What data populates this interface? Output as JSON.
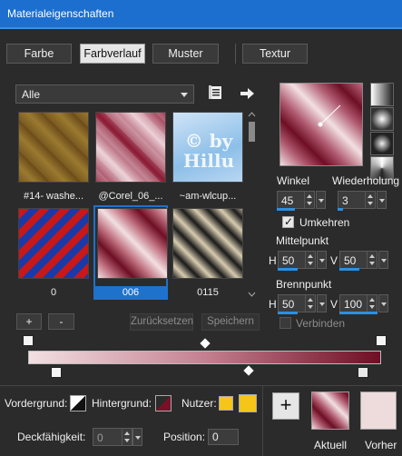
{
  "window": {
    "title": "Materialeigenschaften"
  },
  "tabs": [
    {
      "label": "Farbe"
    },
    {
      "label": "Farbverlauf"
    },
    {
      "label": "Muster"
    },
    {
      "label": "Textur"
    }
  ],
  "active_tab": "Farbverlauf",
  "preset_dropdown": {
    "value": "Alle"
  },
  "gallery": {
    "items": [
      {
        "label": "#14- washe..."
      },
      {
        "label": "@Corel_06_..."
      },
      {
        "label": "~am-wlcup..."
      },
      {
        "label": "0"
      },
      {
        "label": "006"
      },
      {
        "label": "0115"
      }
    ],
    "selected": "006",
    "watermark": "© by Hillu"
  },
  "gallery_buttons": {
    "add": "+",
    "remove": "-",
    "reset": "Zurücksetzen",
    "save": "Speichern"
  },
  "settings": {
    "winkel_label": "Winkel",
    "winkel_value": "45",
    "wiederholung_label": "Wiederholung",
    "wiederholung_value": "3",
    "umkehren_label": "Umkehren",
    "umkehren_checked": true,
    "mittelpunkt_label": "Mittelpunkt",
    "mp_h_label": "H",
    "mp_h_value": "50",
    "mp_v_label": "V",
    "mp_v_value": "50",
    "brennpunkt_label": "Brennpunkt",
    "bp_h_label": "H",
    "bp_h_value": "50",
    "bp_v_label": "V",
    "bp_v_value": "100",
    "verbinden_label": "Verbinden",
    "verbinden_checked": false
  },
  "bottom": {
    "vordergrund_label": "Vordergrund:",
    "hintergrund_label": "Hintergrund:",
    "nutzer_label": "Nutzer:",
    "deckfaehigkeit_label": "Deckfähigkeit:",
    "deckfaehigkeit_value": "0",
    "position_label": "Position:",
    "position_value": "0",
    "add_button": "+",
    "aktuell_label": "Aktuell",
    "vorher_label": "Vorher"
  },
  "colors": {
    "accent": "#1e72cc",
    "gradient_light": "#f2e0e2",
    "gradient_dark": "#6e0e24",
    "nutzer_yellow": "#f5c518",
    "vorher_color": "#eedcdc"
  }
}
